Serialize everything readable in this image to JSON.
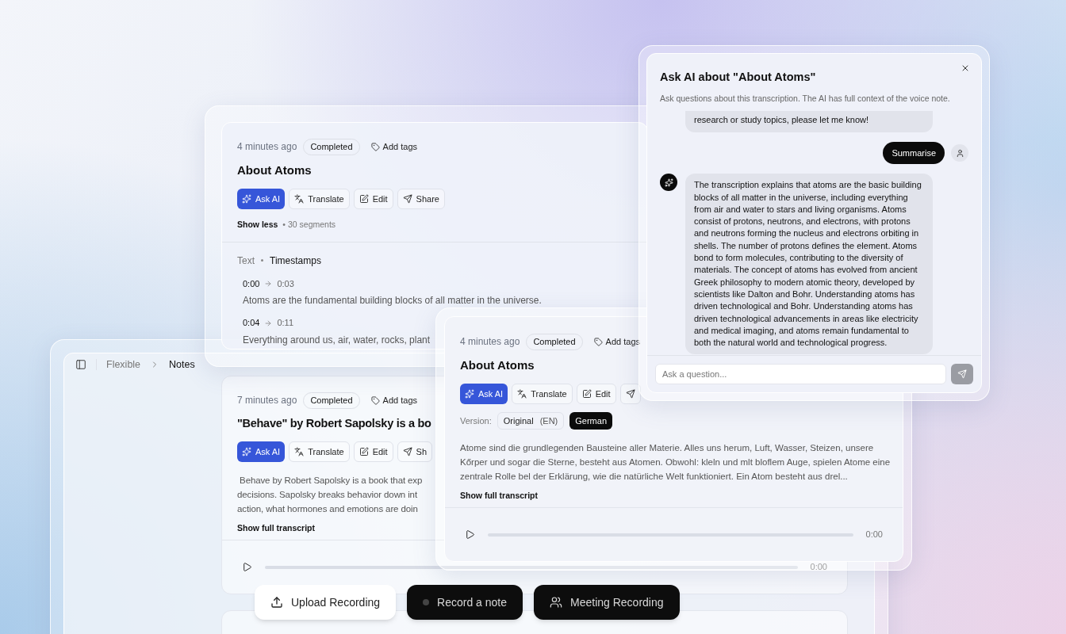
{
  "app_window": {
    "breadcrumb": [
      {
        "label": "Flexible",
        "current": false
      },
      {
        "label": "Notes",
        "current": true
      }
    ],
    "note": {
      "time": "7 minutes ago",
      "status": "Completed",
      "tag_action": "Add tags",
      "title": "\"Behave\" by Robert Sapolsky is a bo",
      "actions": [
        {
          "kind": "ask_ai",
          "label": "Ask AI"
        },
        {
          "kind": "translate",
          "label": "Translate"
        },
        {
          "kind": "edit",
          "label": "Edit"
        },
        {
          "kind": "share",
          "label": "Sh"
        }
      ],
      "summary_lines": [
        " Behave by Robert Sapolsky is a book that exp",
        "decisions. Sapolsky breaks behavior down int",
        "action, what hormones and emotions are doin"
      ],
      "toggle": "Show full transcript",
      "player_time": "0:00"
    }
  },
  "note_card_timestamps": {
    "time": "4 minutes ago",
    "status": "Completed",
    "tag_action": "Add tags",
    "title": "About Atoms",
    "actions": [
      {
        "kind": "ask_ai",
        "label": "Ask AI"
      },
      {
        "kind": "translate",
        "label": "Translate"
      },
      {
        "kind": "edit",
        "label": "Edit"
      },
      {
        "kind": "share",
        "label": "Share"
      }
    ],
    "toggle": "Show less",
    "segment_count": "• 30 segments",
    "views": [
      {
        "label": "Text",
        "selected": false
      },
      {
        "label": "Timestamps",
        "selected": true
      }
    ],
    "segments": [
      {
        "start": "0:00",
        "end": "0:03",
        "text": "Atoms are the fundamental building blocks of all matter in the universe."
      },
      {
        "start": "0:04",
        "end": "0:11",
        "text": "Everything around us, air, water, rocks, plant"
      }
    ]
  },
  "note_card_translated": {
    "time": "4 minutes ago",
    "status": "Completed",
    "tag_action": "Add tags",
    "title": "About Atoms",
    "actions": [
      {
        "kind": "ask_ai",
        "label": "Ask AI"
      },
      {
        "kind": "translate",
        "label": "Translate"
      },
      {
        "kind": "edit",
        "label": "Edit"
      },
      {
        "kind": "share"
      }
    ],
    "version": {
      "label": "Version:",
      "options": [
        {
          "label": "Original",
          "note": "(EN)",
          "selected": false
        },
        {
          "label": "German",
          "selected": true
        }
      ]
    },
    "transcript": "Atome sind die grundlegenden Bausteine aller Materie.  Alles uns herum, Luft, Wasser, Steizen, unsere Kőrper und sogar die Sterne, besteht aus Atomen. Obwohl: kleln und mlt bloflem Auge, spielen Atome eine zentrale Rolle bel der Erklӓrung, wie die natürliche Welt funktioniert. Ein Atom besteht aus drel...",
    "toggle": "Show full transcript",
    "player_time": "0:00"
  },
  "ask_ai_panel": {
    "title": "Ask AI about \"About Atoms\"",
    "subtitle": "Ask questions about this transcription. The AI has full context of the voice note.",
    "messages": [
      {
        "kind": "fragment",
        "text": "research or study topics, please let me know!"
      },
      {
        "kind": "user",
        "text": "Summarise"
      },
      {
        "kind": "assistant",
        "text": "The transcription explains that atoms are the basic building blocks of all matter in the universe, including everything from air and water to stars and living organisms. Atoms consist of protons, neutrons, and electrons, with protons and neutrons forming the nucleus and electrons orbiting in shells. The number of protons defines the element. Atoms bond to form molecules, contributing to the diversity of materials. The concept of atoms has evolved from ancient Greek philosophy to modern atomic theory, developed by scientists like Dalton and Bohr. Understanding atoms has driven technological and Bohr. Understanding atoms has driven technological advancements in areas like electricity and medical imaging, and atoms remain fundamental to both the natural world and technological progress."
      }
    ],
    "input_placeholder": "Ask a question..."
  },
  "record_actions": [
    {
      "kind": "upload",
      "label": "Upload Recording"
    },
    {
      "kind": "record",
      "label": "Record a note"
    },
    {
      "kind": "meeting",
      "label": "Meeting Recording"
    }
  ]
}
